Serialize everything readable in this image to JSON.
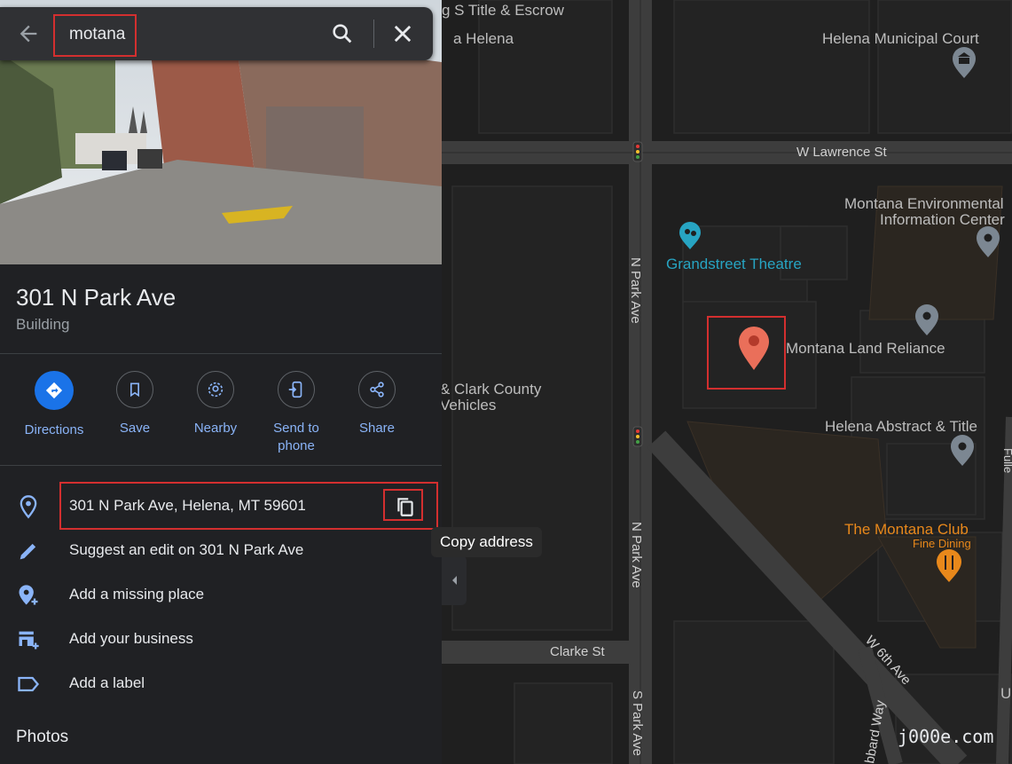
{
  "search": {
    "query": "motana"
  },
  "place": {
    "title": "301 N Park Ave",
    "category": "Building"
  },
  "actions": [
    {
      "label": "Directions",
      "icon": "directions-icon"
    },
    {
      "label": "Save",
      "icon": "bookmark-icon"
    },
    {
      "label": "Nearby",
      "icon": "nearby-icon"
    },
    {
      "label": "Send to phone",
      "icon": "phone-icon"
    },
    {
      "label": "Share",
      "icon": "share-icon"
    }
  ],
  "info_rows": {
    "address": "301 N Park Ave, Helena, MT 59601",
    "suggest_edit": "Suggest an edit on 301 N Park Ave",
    "add_place": "Add a missing place",
    "add_business": "Add your business",
    "add_label": "Add a label"
  },
  "tooltip": "Copy address",
  "photos_heading": "Photos",
  "map": {
    "streets": {
      "w_lawrence": "W Lawrence St",
      "n_park_upper": "N Park Ave",
      "n_park_lower": "N Park Ave",
      "clarke": "Clarke St",
      "w_6th": "W 6th Ave",
      "s_park": "S Park Ave",
      "hubbard": "bbard Way",
      "fuller": "Fulle"
    },
    "pois": {
      "title_escrow": "g S Title & Escrow",
      "helena_partial": "a Helena",
      "municipal_court": "Helena Municipal Court",
      "env_info_1": "Montana Environmental",
      "env_info_2": "Information Center",
      "grandstreet": "Grandstreet Theatre",
      "land_reliance": "Montana Land Reliance",
      "county_1": "& Clark County",
      "county_2": "Vehicles",
      "abstract_title": "Helena Abstract & Title",
      "montana_club": "The Montana Club",
      "fine_dining": "Fine Dining",
      "edge_u": "U"
    },
    "colors": {
      "background": "#1f1f1f",
      "road": "#3c3c3c",
      "poi_teal": "#27a4c2",
      "restaurant": "#e8881b",
      "pin": "#ea6f5a"
    }
  },
  "watermark": "j000e.com"
}
